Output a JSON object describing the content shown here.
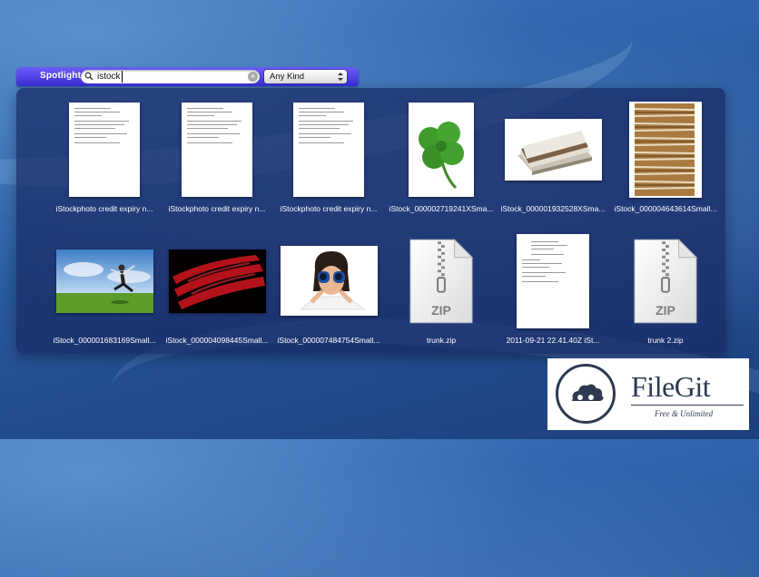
{
  "spotlight": {
    "label": "Spotlight",
    "search_value": "istock",
    "kind_selected": "Any Kind"
  },
  "results": [
    {
      "caption": "iStockphoto credit expiry n...",
      "kind": "document"
    },
    {
      "caption": "iStockphoto credit expiry n...",
      "kind": "document"
    },
    {
      "caption": "iStockphoto credit expiry n...",
      "kind": "document"
    },
    {
      "caption": "iStock_000002719241XSma...",
      "kind": "clover-photo"
    },
    {
      "caption": "iStock_000001932528XSma...",
      "kind": "papers-photo"
    },
    {
      "caption": "iStock_000004643614Small...",
      "kind": "stack-photo"
    },
    {
      "caption": "iStock_000001683169Small...",
      "kind": "jumping-man-photo"
    },
    {
      "caption": "iStock_000004098445Small...",
      "kind": "red-seats-photo"
    },
    {
      "caption": "iStock_000007484754Small...",
      "kind": "binoculars-photo"
    },
    {
      "caption": "trunk.zip",
      "kind": "zip",
      "badge": "ZIP"
    },
    {
      "caption": "2011-09-21 22.41.40Z  iSt...",
      "kind": "document"
    },
    {
      "caption": "trunk 2.zip",
      "kind": "zip",
      "badge": "ZIP"
    }
  ],
  "watermark": {
    "name": "FileGit",
    "tagline": "Free & Unlimited"
  },
  "colors": {
    "spotlight_bar": "#3a2fd8",
    "panel": "#172a64",
    "brand": "#2d3a52"
  }
}
